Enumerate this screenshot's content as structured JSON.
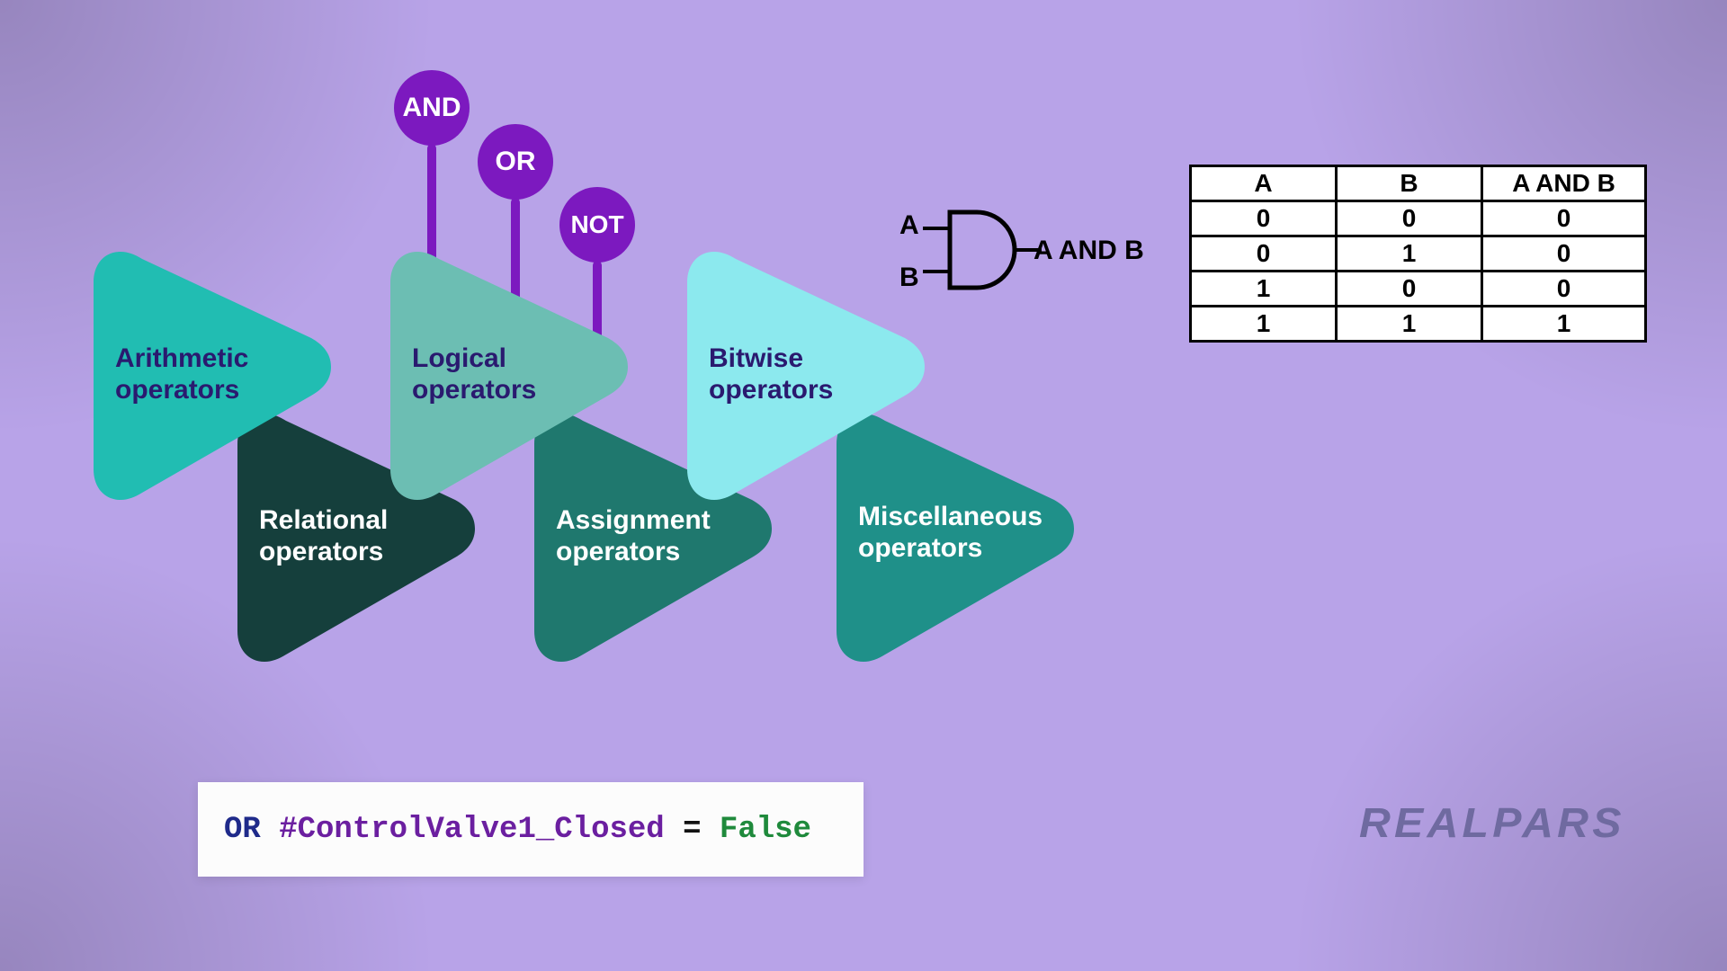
{
  "colors": {
    "bg": "#b8a3e8",
    "teal": "#21bdb2",
    "teal_muted": "#6cbeb3",
    "cyan": "#8ce9ee",
    "dark_teal": "#153f3c",
    "mid_teal": "#1f786e",
    "sea_teal": "#1f9089",
    "purple": "#7c19bf",
    "label_dark": "#2a1a6f"
  },
  "triangles": {
    "arithmetic": {
      "line1": "Arithmetic",
      "line2": "operators"
    },
    "logical": {
      "line1": "Logical",
      "line2": "operators"
    },
    "bitwise": {
      "line1": "Bitwise",
      "line2": "operators"
    },
    "relational": {
      "line1": "Relational",
      "line2": "operators"
    },
    "assignment": {
      "line1": "Assignment",
      "line2": "operators"
    },
    "misc": {
      "line1": "Miscellaneous",
      "line2": "operators"
    }
  },
  "lollipops": {
    "and": "AND",
    "or": "OR",
    "not": "NOT"
  },
  "gate": {
    "in_a": "A",
    "in_b": "B",
    "out": "A AND B"
  },
  "truth_table": {
    "headers": [
      "A",
      "B",
      "A AND B"
    ],
    "rows": [
      [
        "0",
        "0",
        "0"
      ],
      [
        "0",
        "1",
        "0"
      ],
      [
        "1",
        "0",
        "0"
      ],
      [
        "1",
        "1",
        "1"
      ]
    ]
  },
  "code": {
    "kw": "OR",
    "ident": "#ControlValve1_Closed",
    "eq": "=",
    "value": "False"
  },
  "brand": "REALPARS",
  "chart_data": {
    "type": "table",
    "title": "AND truth table",
    "columns": [
      "A",
      "B",
      "A AND B"
    ],
    "rows": [
      [
        0,
        0,
        0
      ],
      [
        0,
        1,
        0
      ],
      [
        1,
        0,
        0
      ],
      [
        1,
        1,
        1
      ]
    ]
  }
}
